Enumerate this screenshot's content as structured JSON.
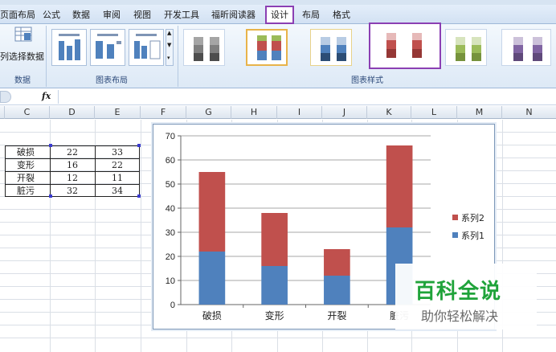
{
  "ribbon_tabs": [
    {
      "label": "页面布局",
      "active": false
    },
    {
      "label": "公式",
      "active": false
    },
    {
      "label": "数据",
      "active": false
    },
    {
      "label": "审阅",
      "active": false
    },
    {
      "label": "视图",
      "active": false
    },
    {
      "label": "开发工具",
      "active": false
    },
    {
      "label": "福昕阅读器",
      "active": false
    },
    {
      "label": "设计",
      "active": true
    },
    {
      "label": "布局",
      "active": false
    },
    {
      "label": "格式",
      "active": false
    }
  ],
  "ribbon": {
    "data_group": {
      "switch_label": "列",
      "select_data_label": "选择数据",
      "group_label": "数据"
    },
    "layout_group": {
      "group_label": "图表布局"
    },
    "styles_group": {
      "group_label": "图表样式"
    }
  },
  "formula_bar": {
    "fx_label": "fx",
    "value": ""
  },
  "columns": [
    "C",
    "D",
    "E",
    "F",
    "G",
    "H",
    "I",
    "J",
    "K",
    "L",
    "M",
    "N"
  ],
  "table": {
    "rows": [
      {
        "label": "破损",
        "s1": "22",
        "s2": "33"
      },
      {
        "label": "变形",
        "s1": "16",
        "s2": "22"
      },
      {
        "label": "开裂",
        "s1": "12",
        "s2": "11"
      },
      {
        "label": "脏污",
        "s1": "32",
        "s2": "34"
      }
    ]
  },
  "colors": {
    "series1": "#4f81bd",
    "series2": "#c0504d",
    "accent_purple": "#8b3fb3",
    "ribbon_bg": "#dde9f6"
  },
  "chart_data": {
    "type": "bar",
    "stacked": true,
    "categories": [
      "破损",
      "变形",
      "开裂",
      "脏污"
    ],
    "series": [
      {
        "name": "系列1",
        "values": [
          22,
          16,
          12,
          32
        ],
        "color": "#4f81bd"
      },
      {
        "name": "系列2",
        "values": [
          33,
          22,
          11,
          34
        ],
        "color": "#c0504d"
      }
    ],
    "ylim": [
      0,
      70
    ],
    "yticks": [
      "0",
      "10",
      "20",
      "30",
      "40",
      "50",
      "60",
      "70"
    ],
    "grid": true,
    "legend": "right"
  },
  "watermark": {
    "title": "百科全说",
    "subtitle": "助你轻松解决"
  }
}
